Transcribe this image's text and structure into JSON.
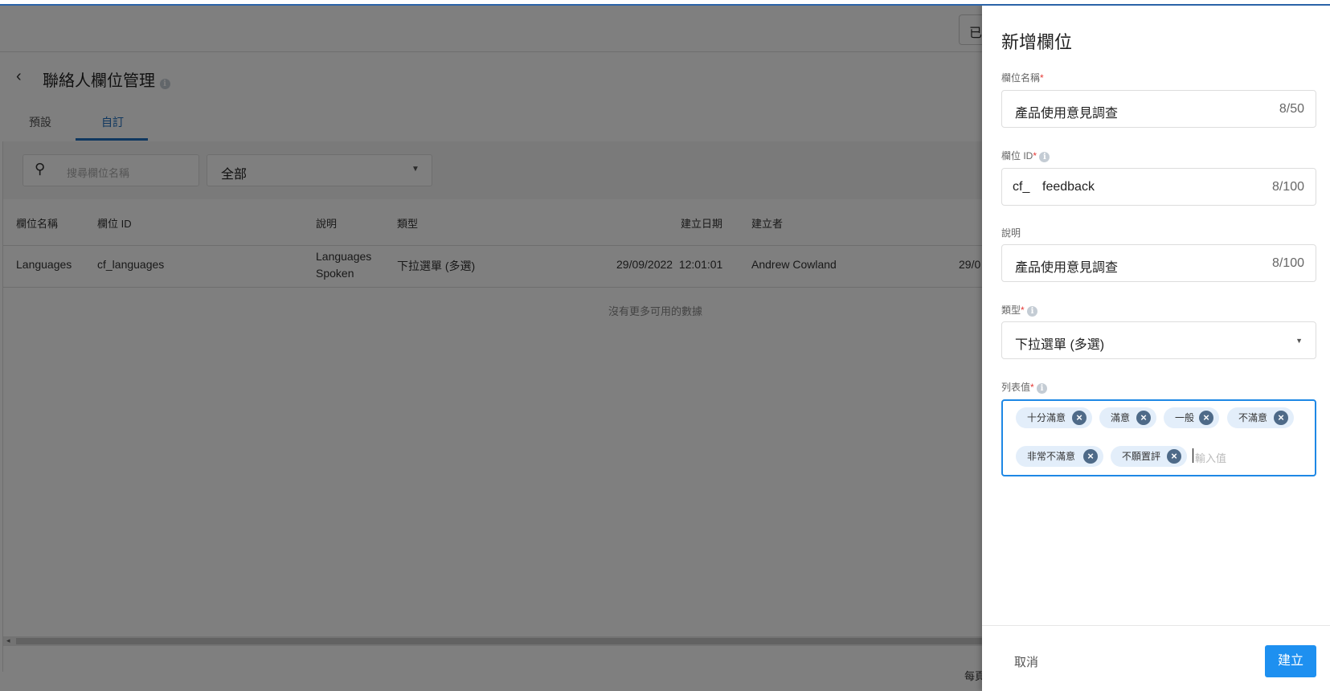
{
  "page": {
    "title": "聯絡人欄位管理",
    "tabs": [
      {
        "label": "預設"
      },
      {
        "label": "自訂"
      }
    ],
    "search_placeholder": "搜尋欄位名稱",
    "filter_value": "全部",
    "top_button_partial": "已",
    "table": {
      "headers": [
        "欄位名稱",
        "欄位 ID",
        "說明",
        "類型",
        "建立日期",
        "建立者"
      ],
      "rows": [
        {
          "name": "Languages",
          "id": "cf_languages",
          "desc_line1": "Languages",
          "desc_line2": "Spoken",
          "type": "下拉選單 (多選)",
          "created": "29/09/2022  12:01:01",
          "creator": "Andrew Cowland",
          "updated_partial": "29/0"
        }
      ],
      "empty_text": "沒有更多可用的數據"
    },
    "footer_partial": "每頁"
  },
  "panel": {
    "title": "新增欄位",
    "field_name": {
      "label": "欄位名稱",
      "value": "產品使用意見調查",
      "counter": "8/50"
    },
    "field_id": {
      "label": "欄位 ID",
      "prefix": "cf_",
      "value": "feedback",
      "counter": "8/100"
    },
    "description": {
      "label": "說明",
      "value": "產品使用意見調查",
      "counter": "8/100"
    },
    "type": {
      "label": "類型",
      "value": "下拉選單 (多選)"
    },
    "list_values": {
      "label": "列表值",
      "tags": [
        "十分滿意",
        "滿意",
        "一般",
        "不滿意",
        "非常不滿意",
        "不願置評"
      ],
      "placeholder": "輸入值"
    },
    "required_mark": "*",
    "cancel_label": "取消",
    "create_label": "建立"
  },
  "colors": {
    "accent": "#1e90f0",
    "tab_active": "#1f6fbf",
    "focus_border": "#1e88e5",
    "chip_bg": "#e3eefa"
  }
}
